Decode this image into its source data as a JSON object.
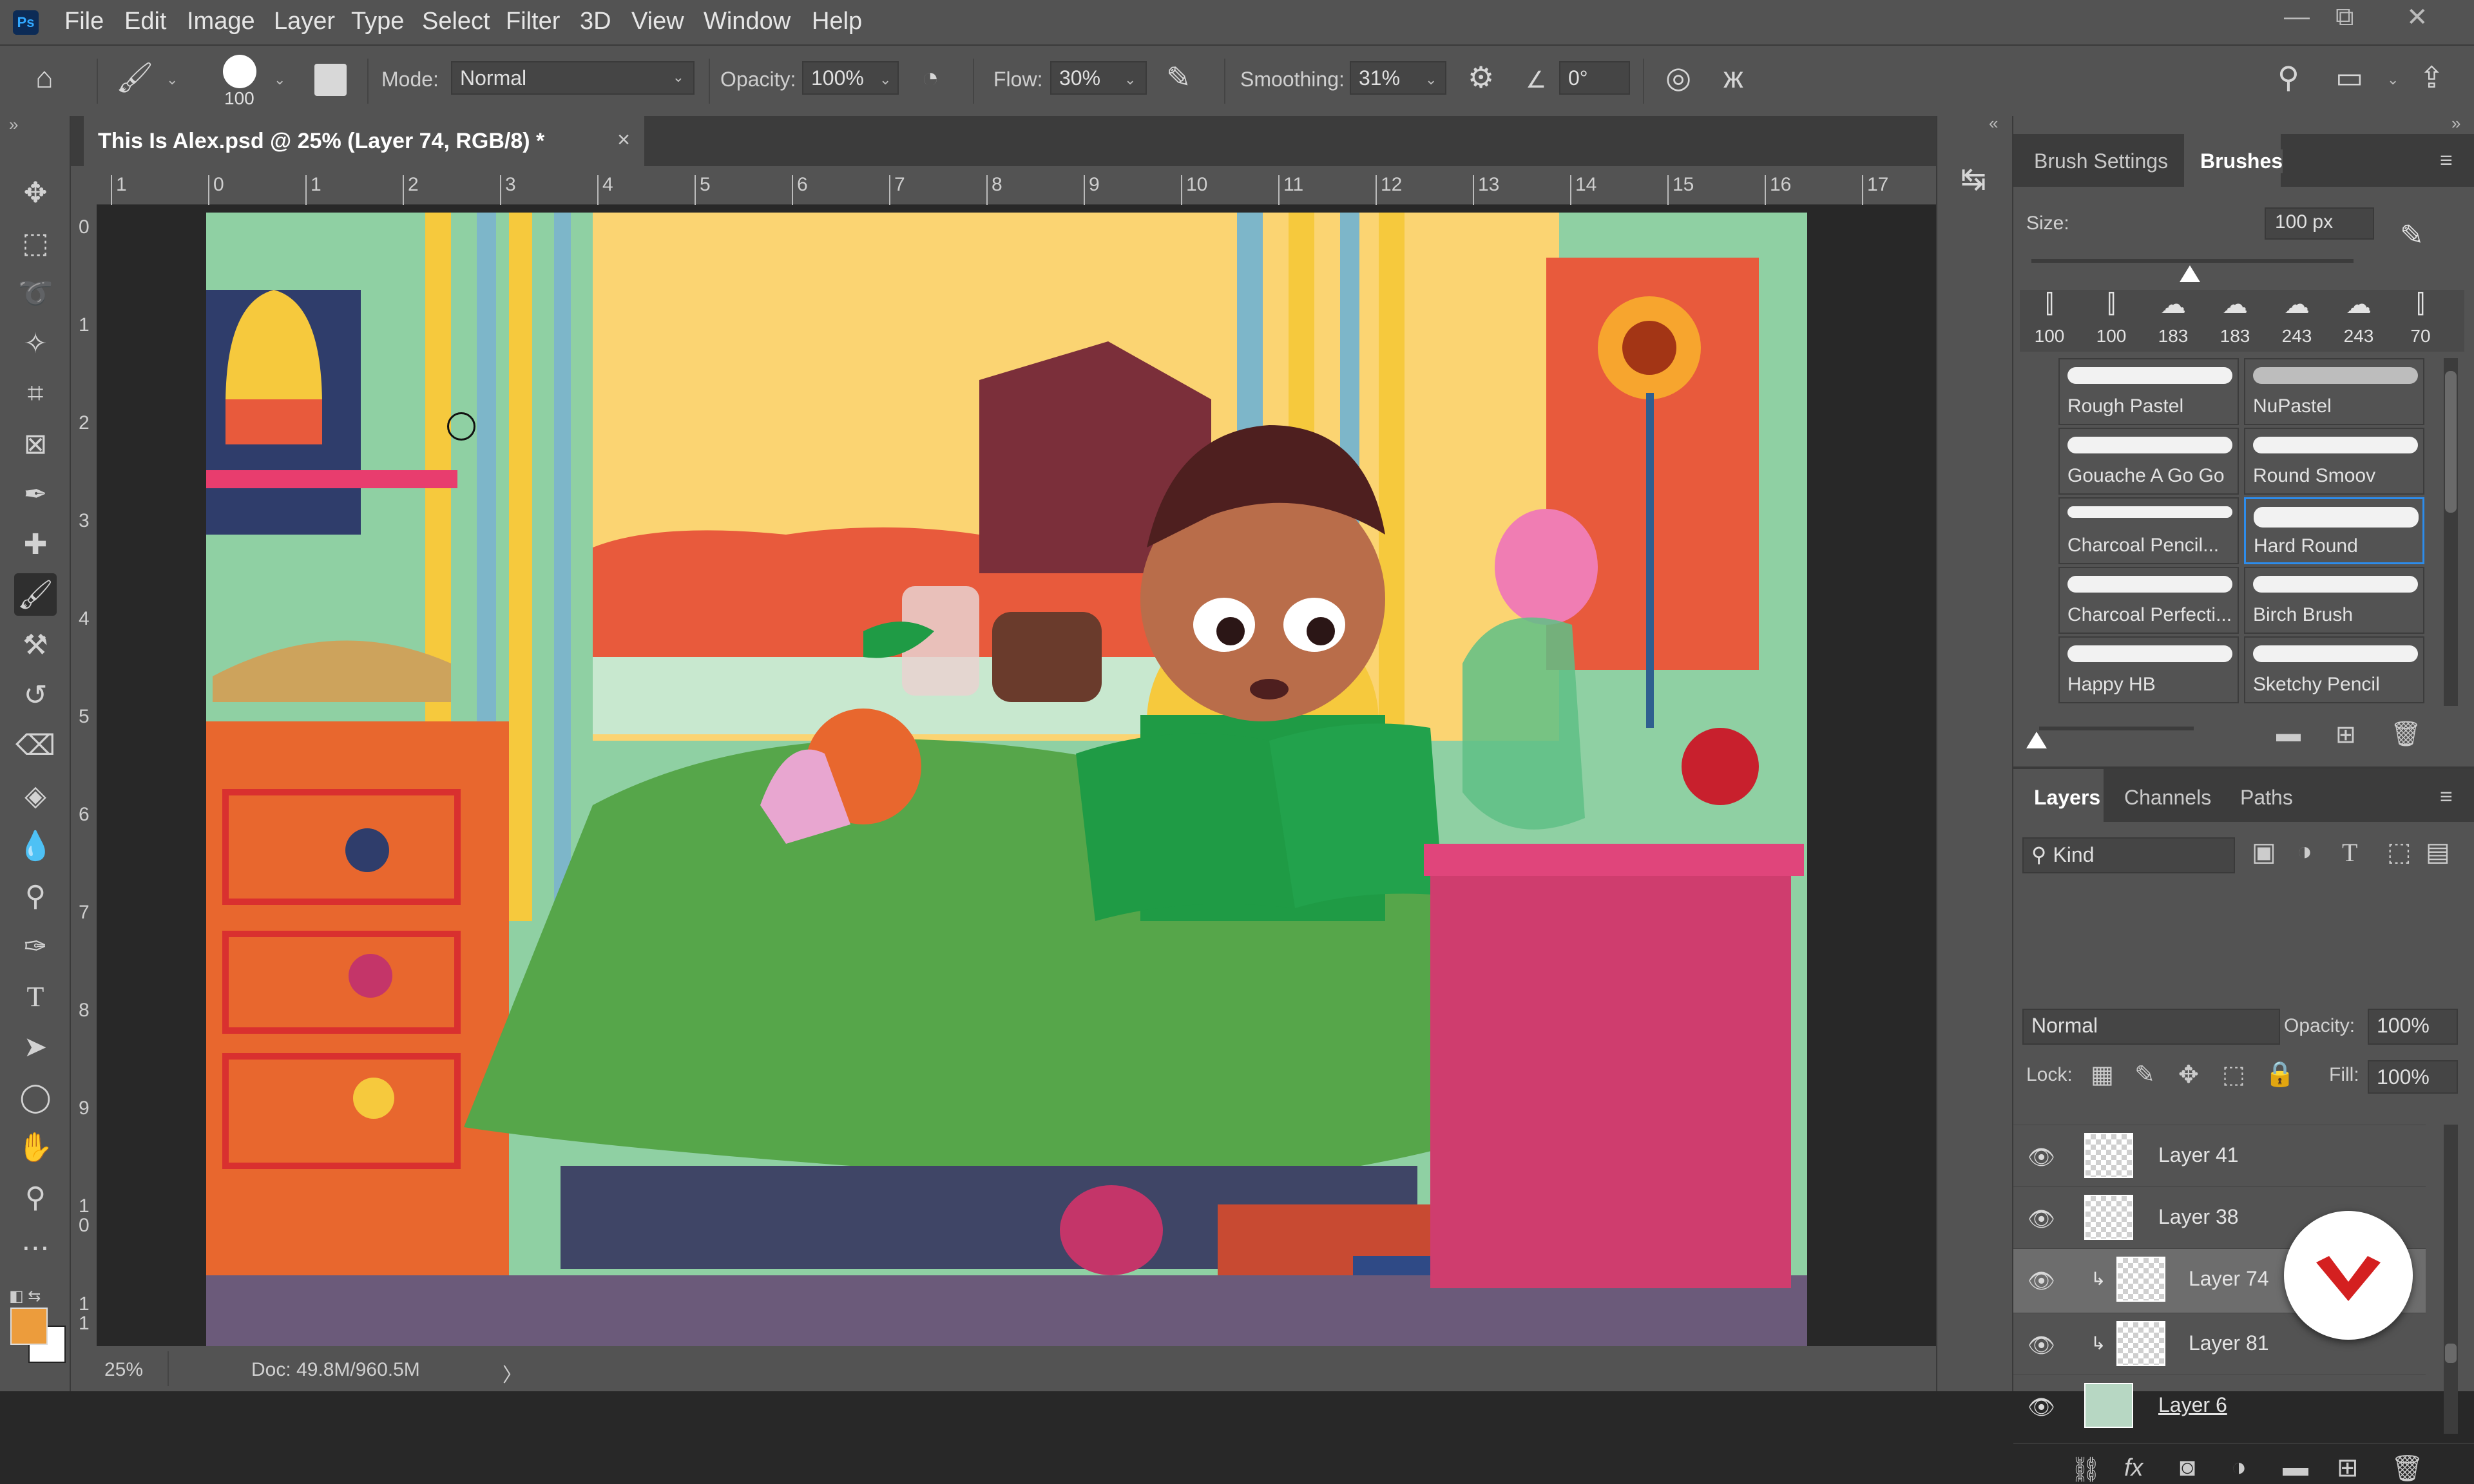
{
  "menubar": {
    "items": [
      "File",
      "Edit",
      "Image",
      "Layer",
      "Type",
      "Select",
      "Filter",
      "3D",
      "View",
      "Window",
      "Help"
    ],
    "logo": "Ps",
    "minimize_glyph": "—",
    "restore_glyph": "⧉",
    "close_glyph": "✕"
  },
  "options": {
    "brush_size": "100",
    "mode_label": "Mode:",
    "mode_value": "Normal",
    "opacity_label": "Opacity:",
    "opacity_value": "100%",
    "flow_label": "Flow:",
    "flow_value": "30%",
    "smoothing_label": "Smoothing:",
    "smoothing_value": "31%",
    "angle_value": "0°"
  },
  "document": {
    "tab_title": "This Is Alex.psd @ 25% (Layer 74, RGB/8) *",
    "close_glyph": "×",
    "ruler_h": [
      "1",
      "0",
      "1",
      "2",
      "3",
      "4",
      "5",
      "6",
      "7",
      "8",
      "9",
      "10",
      "11",
      "12",
      "13",
      "14",
      "15",
      "16",
      "17"
    ],
    "ruler_v": [
      "0",
      "1",
      "2",
      "3",
      "4",
      "5",
      "6",
      "7",
      "8",
      "9",
      "1\n0",
      "1\n1"
    ]
  },
  "status": {
    "zoom": "25%",
    "doc_info": "Doc: 49.8M/960.5M",
    "arrow": "〉"
  },
  "brushes_panel": {
    "tabs": [
      "Brush Settings",
      "Brushes"
    ],
    "size_label": "Size:",
    "size_value": "100 px",
    "presets": [
      "100",
      "100",
      "183",
      "183",
      "243",
      "243",
      "70"
    ],
    "brushes": [
      "Rough Pastel",
      "NuPastel",
      "Gouache A Go Go",
      "Round Smoov",
      "Charcoal Pencil...",
      "Hard Round",
      "Charcoal Perfecti...",
      "Birch Brush",
      "Happy HB",
      "Sketchy Pencil"
    ]
  },
  "layers_panel": {
    "tabs": [
      "Layers",
      "Channels",
      "Paths"
    ],
    "kind_label": "Kind",
    "blend_mode": "Normal",
    "opacity_label": "Opacity:",
    "opacity_value": "100%",
    "lock_label": "Lock:",
    "fill_label": "Fill:",
    "fill_value": "100%",
    "layers": [
      "Layer 41",
      "Layer 38",
      "Layer 74",
      "Layer 81",
      "Layer 6"
    ]
  },
  "colors": {
    "foreground": "#ec9c3c",
    "background": "#ffffff",
    "accent_selection": "#2d8ceb"
  }
}
